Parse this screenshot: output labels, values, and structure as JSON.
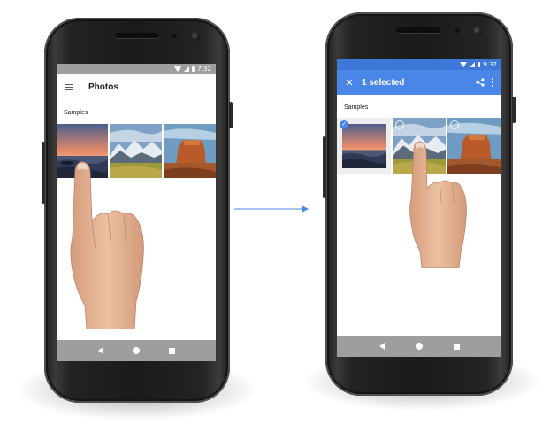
{
  "left_phone": {
    "status_time": "7:32",
    "app_title": "Photos",
    "section_label": "Samples"
  },
  "right_phone": {
    "status_time": "9:37",
    "selection_title": "1 selected",
    "section_label": "Samples"
  },
  "icons": {
    "nav": [
      "back-icon",
      "home-icon",
      "recents-icon"
    ],
    "status": [
      "wifi-icon",
      "signal-icon",
      "battery-icon"
    ],
    "appbar_left": [
      "menu-icon"
    ],
    "appbar_right": [
      "close-icon",
      "share-icon",
      "more-icon"
    ],
    "selection": [
      "check-icon",
      "radio-icon"
    ]
  },
  "colors": {
    "statusbar": "#9e9e9e",
    "statusbar_selected": "#3d77d8",
    "selection_bar": "#4a86e8",
    "navbar": "#9e9e9e",
    "arrow": "#4a86e8"
  }
}
